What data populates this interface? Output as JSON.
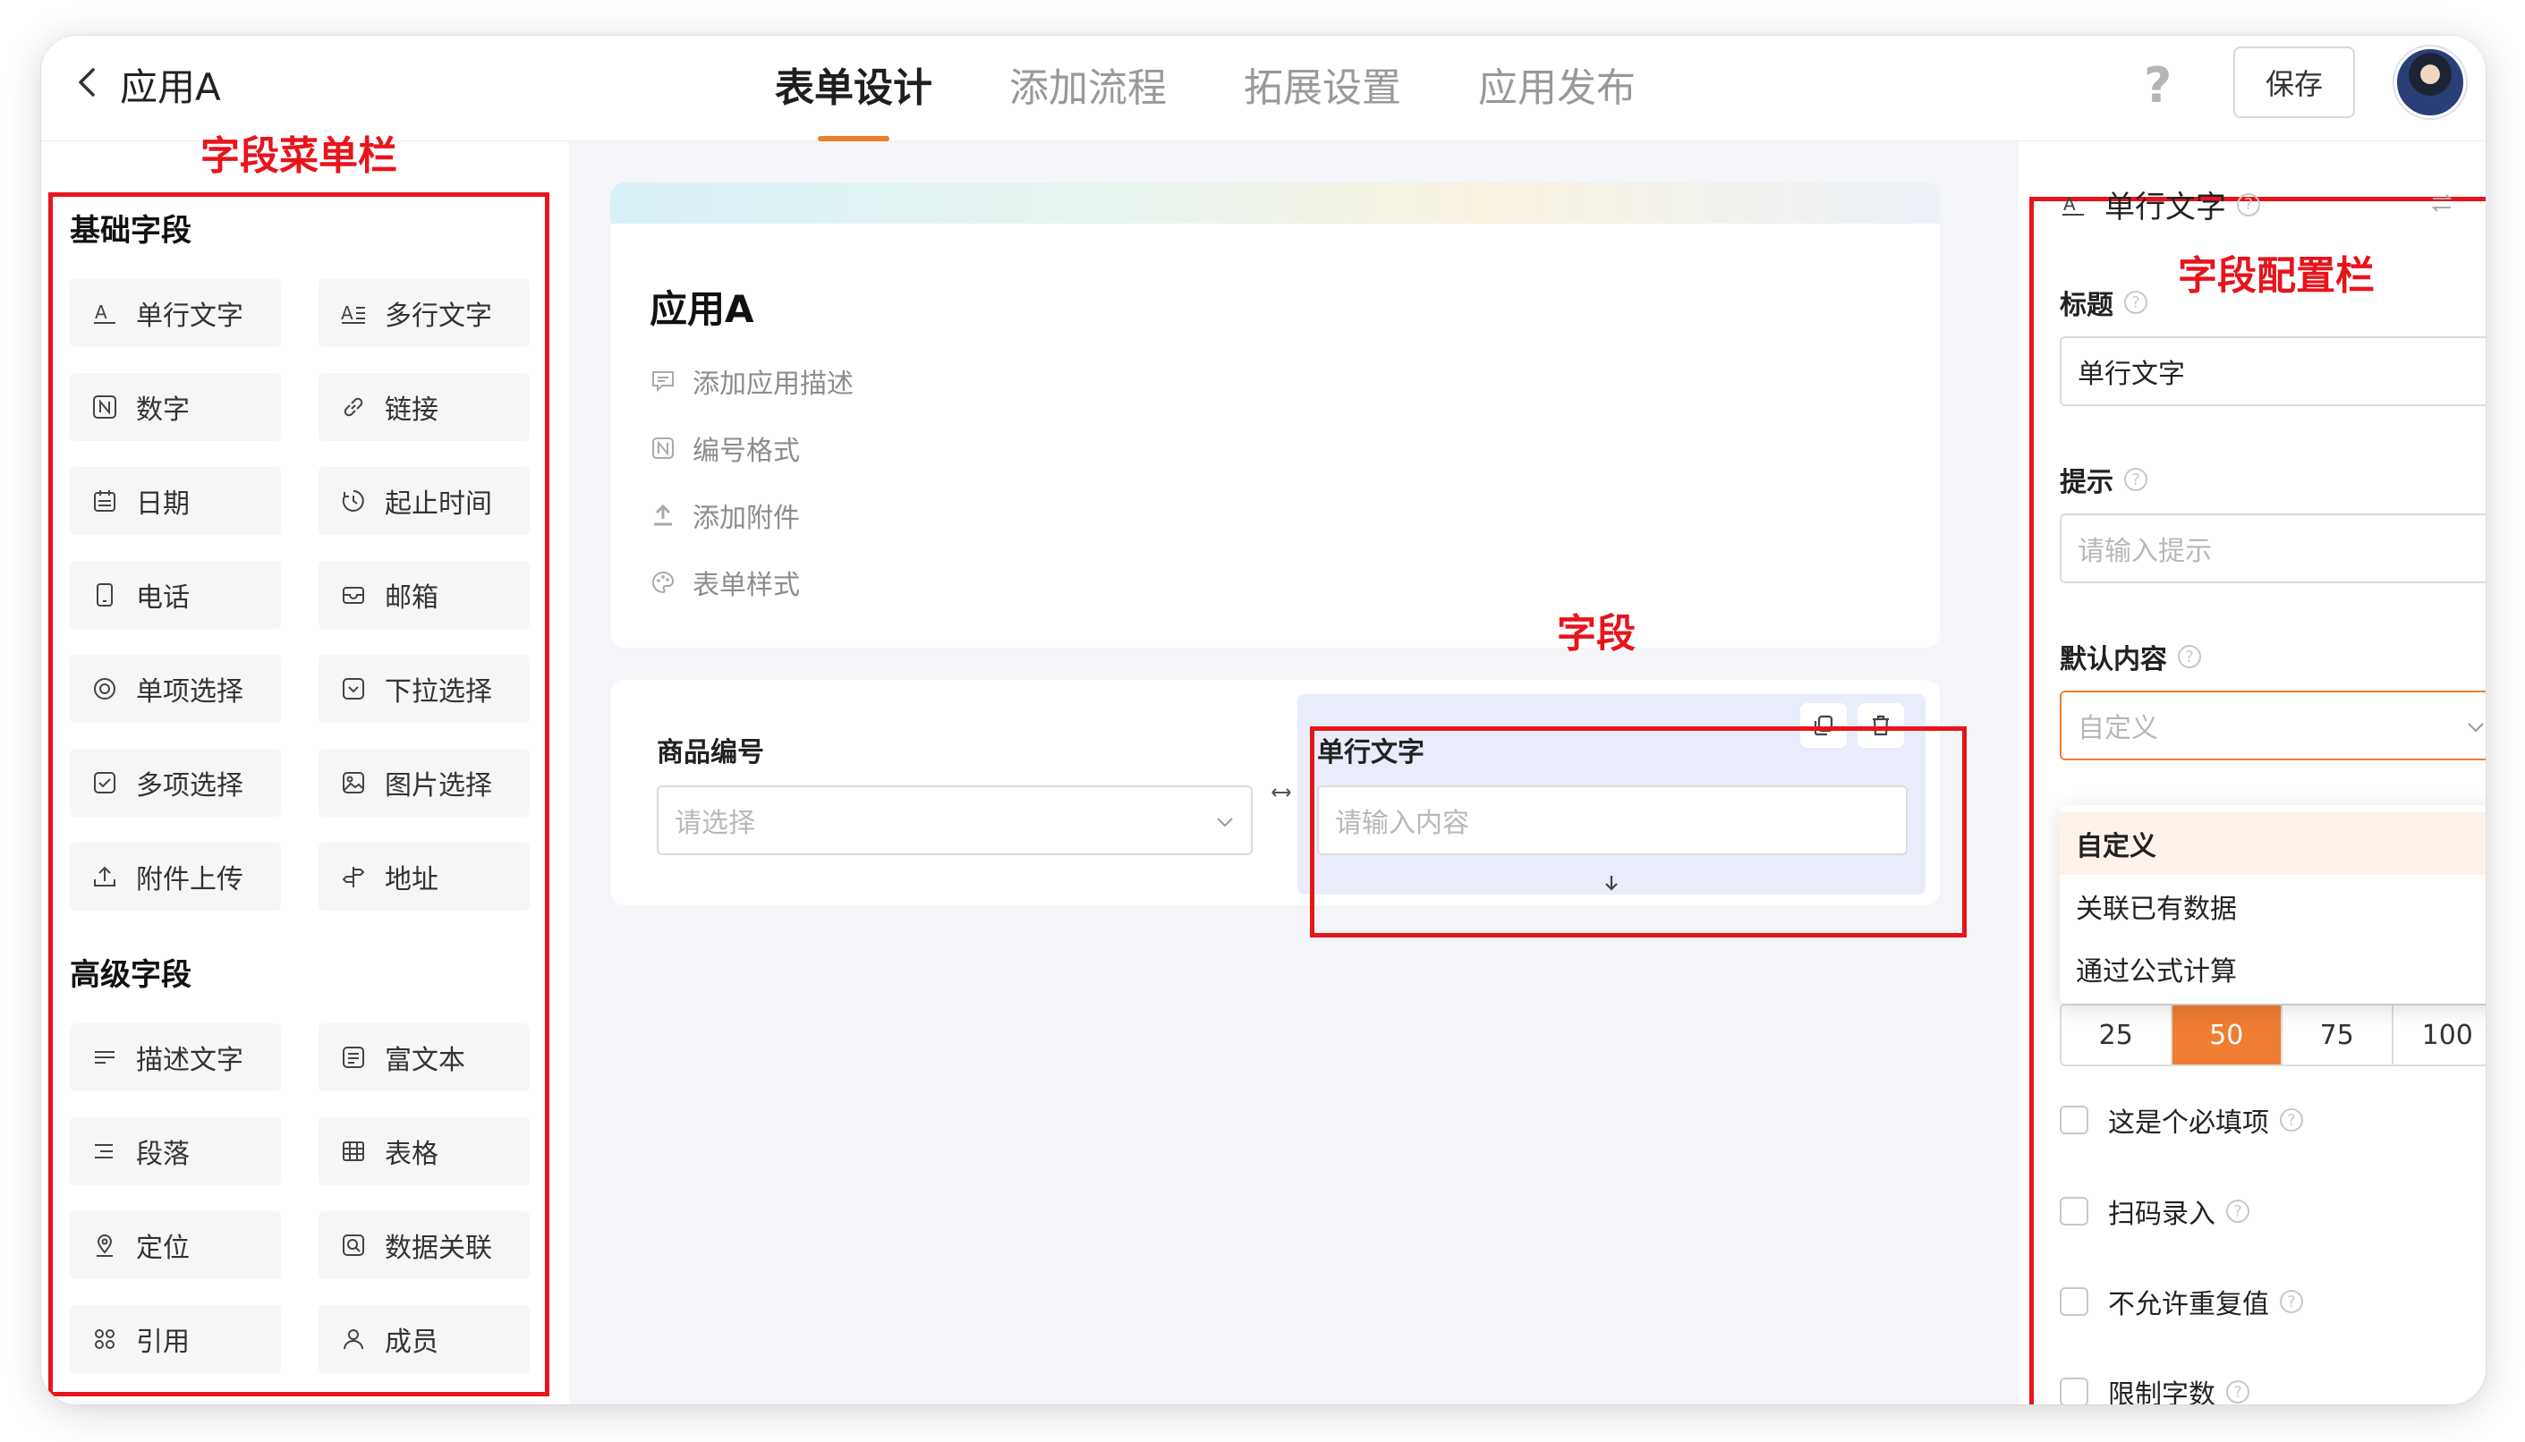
{
  "header": {
    "app_title": "应用A",
    "tabs": [
      {
        "label": "表单设计",
        "active": true
      },
      {
        "label": "添加流程",
        "active": false
      },
      {
        "label": "拓展设置",
        "active": false
      },
      {
        "label": "应用发布",
        "active": false
      }
    ],
    "help": "?",
    "save_label": "保存"
  },
  "annotations": {
    "sidebar": "字段菜单栏",
    "field": "字段",
    "panel": "字段配置栏"
  },
  "sidebar": {
    "basic_title": "基础字段",
    "basic_fields": [
      "单行文字",
      "多行文字",
      "数字",
      "链接",
      "日期",
      "起止时间",
      "电话",
      "邮箱",
      "单项选择",
      "下拉选择",
      "多项选择",
      "图片选择",
      "附件上传",
      "地址"
    ],
    "advanced_title": "高级字段",
    "advanced_fields": [
      "描述文字",
      "富文本",
      "段落",
      "表格",
      "定位",
      "数据关联",
      "引用",
      "成员"
    ]
  },
  "canvas": {
    "app_card": {
      "title": "应用A",
      "links": [
        "添加应用描述",
        "编号格式",
        "添加附件",
        "表单样式"
      ]
    },
    "form": {
      "field1": {
        "label": "商品编号",
        "placeholder": "请选择"
      },
      "field2": {
        "label": "单行文字",
        "placeholder": "请输入内容"
      }
    }
  },
  "panel": {
    "field_type": "单行文字",
    "title_label": "标题",
    "title_value": "单行文字",
    "hint_label": "提示",
    "hint_placeholder": "请输入提示",
    "default_label": "默认内容",
    "default_value": "自定义",
    "default_options": [
      "自定义",
      "关联已有数据",
      "通过公式计算"
    ],
    "width_options": [
      "25",
      "50",
      "75",
      "100"
    ],
    "width_selected": "50",
    "checkboxes": [
      "这是个必填项",
      "扫码录入",
      "不允许重复值",
      "限制字数"
    ]
  },
  "colors": {
    "accent": "#ef7d32",
    "annotation_red": "#e8141c",
    "selected_field_bg": "#e8ecfb"
  }
}
